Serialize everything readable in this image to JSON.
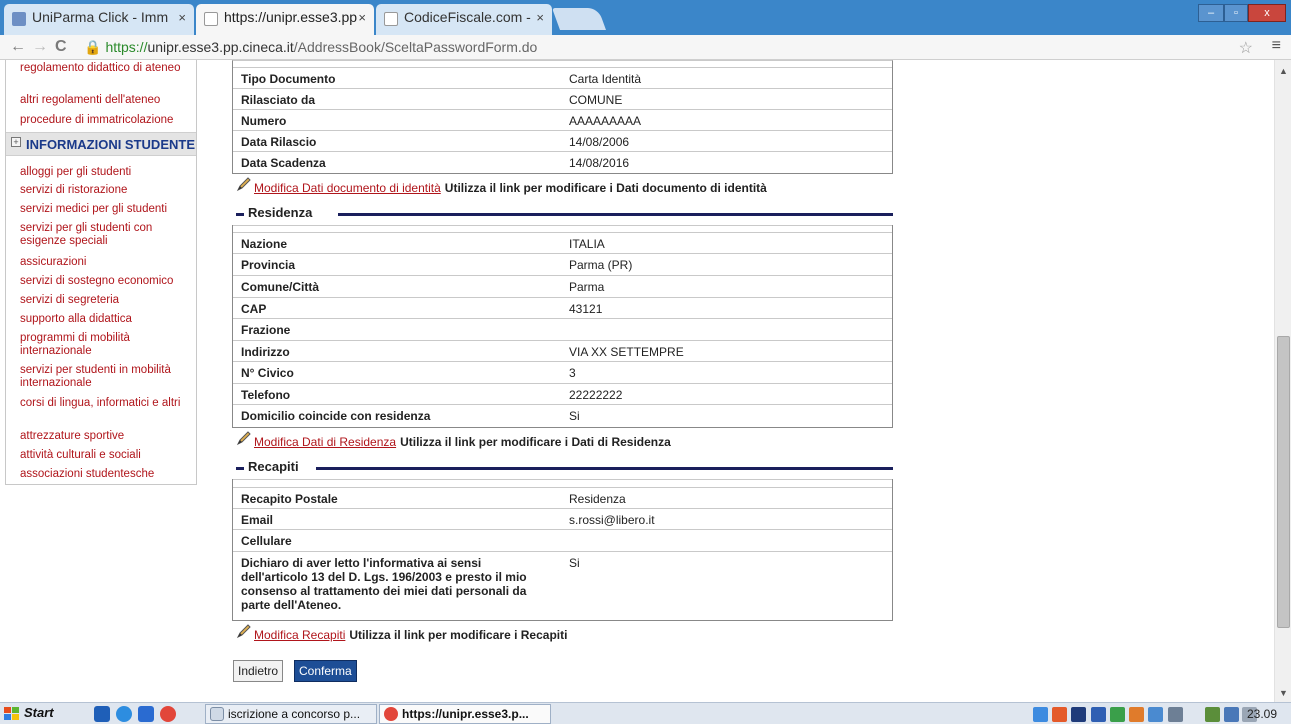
{
  "browser": {
    "tabs": [
      {
        "title": "UniParma Click - Imm",
        "active": false
      },
      {
        "title": "https://unipr.esse3.pp",
        "active": true
      },
      {
        "title": "CodiceFiscale.com -",
        "active": false
      }
    ],
    "url_prefix": "https://",
    "url_host": "unipr.esse3.pp.cineca.it",
    "url_path": "/AddressBook/SceltaPasswordForm.do"
  },
  "sidebar": {
    "links_top": [
      "regolamento didattico di ateneo",
      "altri regolamenti dell'ateneo",
      "procedure di immatricolazione"
    ],
    "section_label": "INFORMAZIONI STUDENTE",
    "links": [
      "alloggi per gli studenti",
      "servizi di ristorazione",
      "servizi medici per gli studenti",
      "servizi per gli studenti con esigenze speciali",
      "assicurazioni",
      "servizi di sostegno economico",
      "servizi di segreteria",
      "supporto alla didattica",
      "programmi di mobilità internazionale",
      "servizi per studenti in mobilità internazionale",
      "corsi di lingua, informatici e altri",
      "attrezzature sportive",
      "attività culturali e sociali",
      "associazioni studentesche"
    ]
  },
  "documento": {
    "rows": [
      {
        "label": "Tipo Documento",
        "value": "Carta Identità"
      },
      {
        "label": "Rilasciato da",
        "value": "COMUNE"
      },
      {
        "label": "Numero",
        "value": "AAAAAAAAA"
      },
      {
        "label": "Data Rilascio",
        "value": "14/08/2006"
      },
      {
        "label": "Data Scadenza",
        "value": "14/08/2016"
      }
    ],
    "edit_link": "Modifica Dati documento di identità",
    "edit_hint": "Utilizza il link per modificare i Dati documento di identità"
  },
  "residenza": {
    "title": "Residenza",
    "rows": [
      {
        "label": "Nazione",
        "value": "ITALIA"
      },
      {
        "label": "Provincia",
        "value": "Parma (PR)"
      },
      {
        "label": "Comune/Città",
        "value": "Parma"
      },
      {
        "label": "CAP",
        "value": "43121"
      },
      {
        "label": "Frazione",
        "value": ""
      },
      {
        "label": "Indirizzo",
        "value": "VIA XX SETTEMPRE"
      },
      {
        "label": "N° Civico",
        "value": "3"
      },
      {
        "label": "Telefono",
        "value": "22222222"
      },
      {
        "label": "Domicilio coincide con residenza",
        "value": "Si"
      }
    ],
    "edit_link": "Modifica Dati di Residenza",
    "edit_hint": "Utilizza il link per modificare i Dati di Residenza"
  },
  "recapiti": {
    "title": "Recapiti",
    "rows": [
      {
        "label": "Recapito Postale",
        "value": "Residenza"
      },
      {
        "label": "Email",
        "value": "s.rossi@libero.it"
      },
      {
        "label": "Cellulare",
        "value": ""
      }
    ],
    "consent_label": "Dichiaro di aver letto l'informativa ai sensi dell'articolo 13 del D. Lgs. 196/2003 e presto il mio consenso al trattamento dei miei dati personali da parte dell'Ateneo.",
    "consent_value": "Si",
    "edit_link": "Modifica Recapiti",
    "edit_hint": "Utilizza il link per modificare i Recapiti"
  },
  "buttons": {
    "back": "Indietro",
    "confirm": "Conferma"
  },
  "taskbar": {
    "start": "Start",
    "tasks": [
      {
        "label": "iscrizione a concorso p...",
        "active": false
      },
      {
        "label": "https://unipr.esse3.p...",
        "active": true
      }
    ],
    "clock": "23.09"
  }
}
